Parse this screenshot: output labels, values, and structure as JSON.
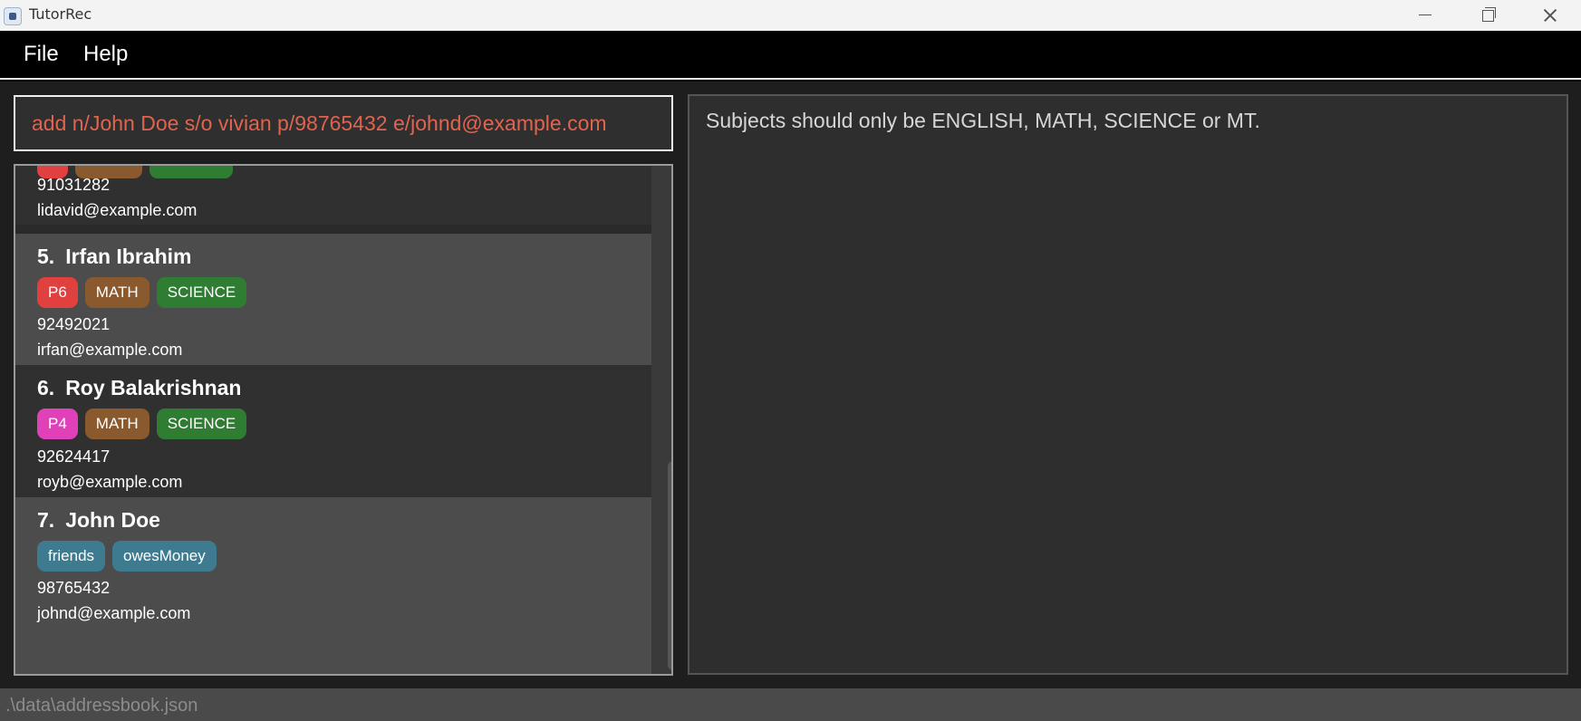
{
  "window": {
    "title": "TutorRec"
  },
  "menu": {
    "file": "File",
    "help": "Help"
  },
  "command": {
    "value": "add n/John Doe s/o vivian p/98765432 e/johnd@example.com"
  },
  "result": {
    "message": "Subjects should only be ENGLISH, MATH, SCIENCE or MT."
  },
  "status": {
    "path": ".\\data\\addressbook.json"
  },
  "colors": {
    "accent_error": "#e0644f",
    "tag_p6": "#e0403e",
    "tag_p4": "#e040b8",
    "tag_math": "#8a5a2e",
    "tag_science": "#2e7d32",
    "tag_generic": "#3e7b91"
  },
  "persons": [
    {
      "index": "",
      "name": "",
      "phone": "91031282",
      "email": "lidavid@example.com",
      "tags": []
    },
    {
      "index": "5.",
      "name": "Irfan Ibrahim",
      "phone": "92492021",
      "email": "irfan@example.com",
      "tags": [
        {
          "label": "P6"
        },
        {
          "label": "MATH"
        },
        {
          "label": "SCIENCE"
        }
      ]
    },
    {
      "index": "6.",
      "name": "Roy Balakrishnan",
      "phone": "92624417",
      "email": "royb@example.com",
      "tags": [
        {
          "label": "P4"
        },
        {
          "label": "MATH"
        },
        {
          "label": "SCIENCE"
        }
      ]
    },
    {
      "index": "7.",
      "name": "John Doe",
      "phone": "98765432",
      "email": "johnd@example.com",
      "tags": [
        {
          "label": "friends"
        },
        {
          "label": "owesMoney"
        }
      ]
    }
  ]
}
